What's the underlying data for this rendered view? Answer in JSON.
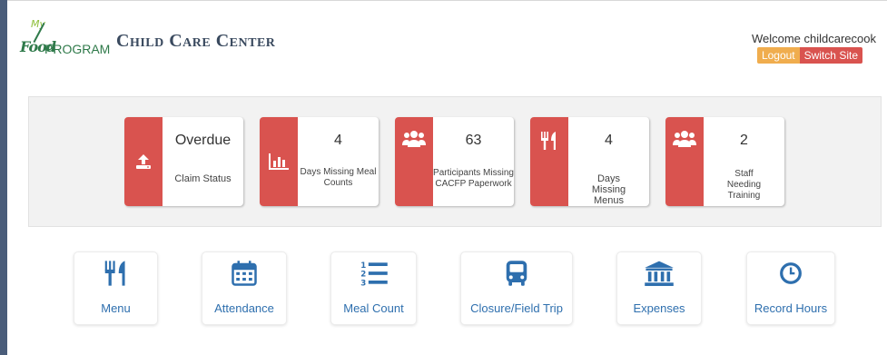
{
  "header": {
    "logo": {
      "text_my": "My",
      "text_food": "Food",
      "text_program": "PROGRAM"
    },
    "title": "Child Care Center",
    "welcome": "Welcome childcarecook",
    "logout_label": "Logout",
    "switch_site_label": "Switch Site"
  },
  "stats": [
    {
      "icon": "upload-icon",
      "value": "Overdue",
      "label": "Claim Status"
    },
    {
      "icon": "bar-chart-icon",
      "value": "4",
      "label": "Days Missing Meal Counts"
    },
    {
      "icon": "users-icon",
      "value": "63",
      "label": "Participants Missing CACFP Paperwork"
    },
    {
      "icon": "utensils-icon",
      "value": "4",
      "label": "Days Missing Menus"
    },
    {
      "icon": "users-icon",
      "value": "2",
      "label": "Staff Needing Training"
    }
  ],
  "actions": [
    {
      "icon": "utensils-icon",
      "label": "Menu"
    },
    {
      "icon": "calendar-icon",
      "label": "Attendance"
    },
    {
      "icon": "numbered-list-icon",
      "label": "Meal Count"
    },
    {
      "icon": "bus-icon",
      "label": "Closure/Field Trip"
    },
    {
      "icon": "bank-icon",
      "label": "Expenses"
    },
    {
      "icon": "clock-icon",
      "label": "Record Hours"
    }
  ],
  "colors": {
    "stat_accent": "#d9534f",
    "action_accent": "#2e6fae",
    "logout": "#f0ad4e",
    "switch_site": "#d9534f",
    "panel_bg": "#f2f2f2",
    "logo_green": "#2f7a4a"
  }
}
